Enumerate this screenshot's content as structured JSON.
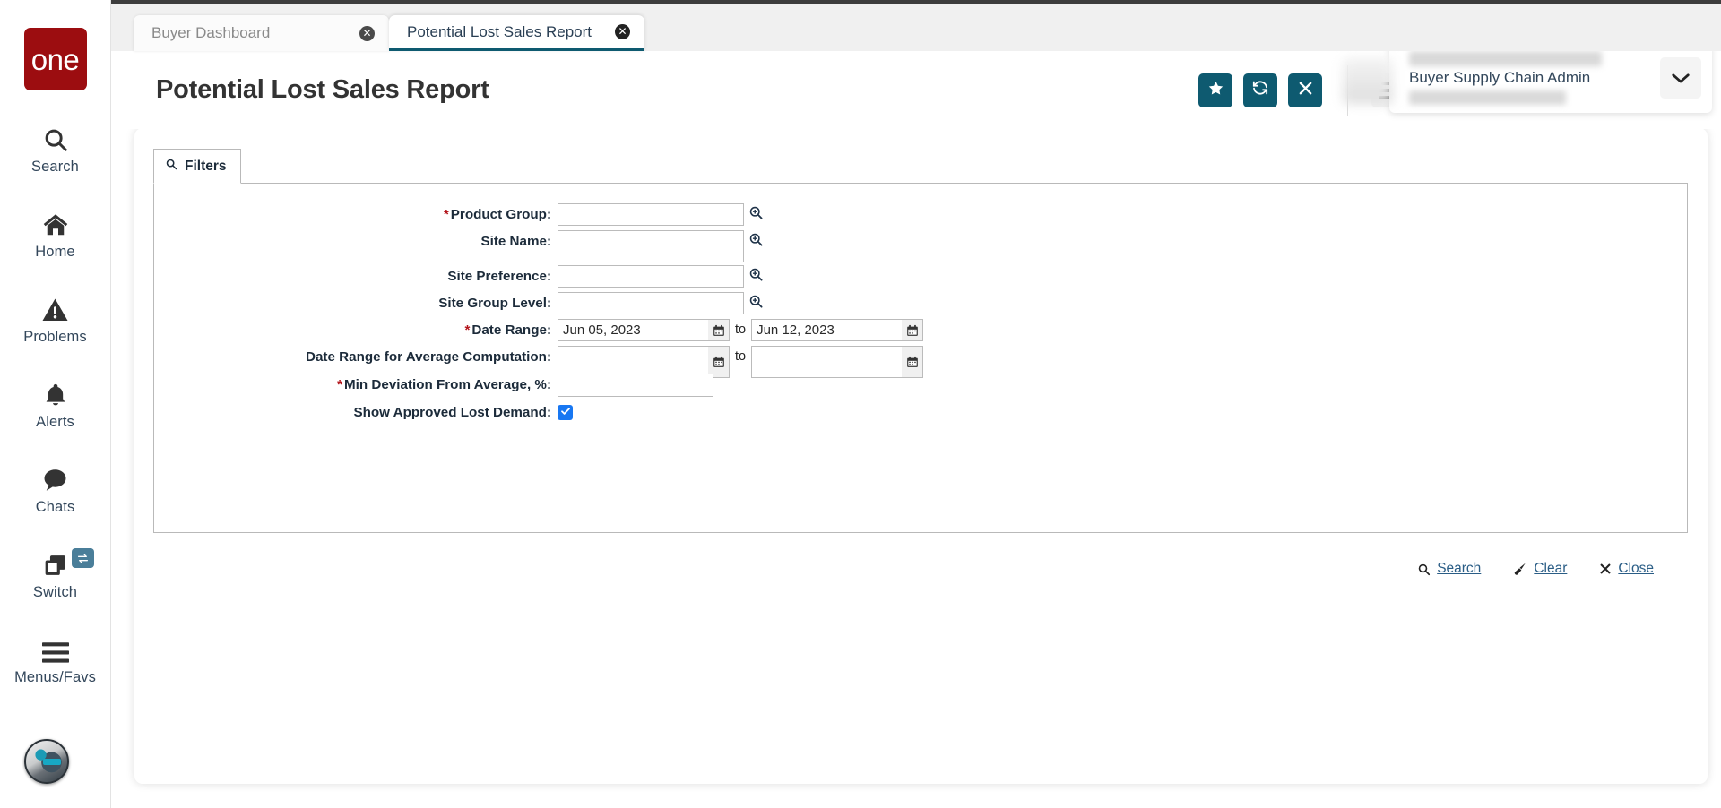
{
  "brand": {
    "logo_text": "one"
  },
  "sidebar": {
    "items": [
      {
        "label": "Search",
        "icon": "search-icon"
      },
      {
        "label": "Home",
        "icon": "home-icon"
      },
      {
        "label": "Problems",
        "icon": "warning-triangle-icon"
      },
      {
        "label": "Alerts",
        "icon": "bell-icon"
      },
      {
        "label": "Chats",
        "icon": "chat-bubble-icon"
      },
      {
        "label": "Switch",
        "icon": "switch-windows-icon",
        "badge_icon": "exchange-arrows-icon"
      },
      {
        "label": "Menus/Favs",
        "icon": "hamburger-icon"
      }
    ],
    "bot_avatar": "robot-assistant-avatar"
  },
  "tabs": [
    {
      "label": "Buyer Dashboard",
      "active": false,
      "close_icon": "close-circle-icon"
    },
    {
      "label": "Potential Lost Sales Report",
      "active": true,
      "close_icon": "close-circle-icon"
    }
  ],
  "header": {
    "title": "Potential Lost Sales Report",
    "buttons": [
      {
        "name": "favorite-button",
        "icon": "star-icon"
      },
      {
        "name": "refresh-button",
        "icon": "refresh-icon"
      },
      {
        "name": "close-button",
        "icon": "x-icon"
      }
    ],
    "menu_button": {
      "icon": "hamburger-icon",
      "badge_icon": "star-icon"
    },
    "user": {
      "name_redacted": "",
      "role": "Buyer Supply Chain Admin",
      "org_redacted": "",
      "caret_icon": "chevron-down-icon",
      "avatar": "user-avatar-blurred"
    },
    "accent_color": "#0e5a70",
    "badge_color": "#9c0d10"
  },
  "filters": {
    "panel_label": "Filters",
    "panel_icon": "search-icon",
    "fields": [
      {
        "name": "product-group",
        "label": "Product Group",
        "required": true,
        "type": "lookup",
        "value": "",
        "lookup_icon": "magnifier-plus-icon"
      },
      {
        "name": "site-name",
        "label": "Site Name",
        "required": false,
        "type": "lookup-tall",
        "value": "",
        "lookup_icon": "magnifier-plus-icon"
      },
      {
        "name": "site-preference",
        "label": "Site Preference",
        "required": false,
        "type": "lookup",
        "value": "",
        "lookup_icon": "magnifier-plus-icon"
      },
      {
        "name": "site-group-level",
        "label": "Site Group Level",
        "required": false,
        "type": "lookup",
        "value": "",
        "lookup_icon": "magnifier-plus-icon"
      }
    ],
    "date_range": {
      "label": "Date Range",
      "required": true,
      "from_value": "Jun 05, 2023",
      "to_value": "Jun 12, 2023",
      "separator": "to",
      "calendar_icon": "calendar-icon"
    },
    "avg_date_range": {
      "label": "Date Range for Average Computation",
      "required": false,
      "from_value": "",
      "to_value": "",
      "separator": "to",
      "calendar_icon": "calendar-icon"
    },
    "min_deviation": {
      "label": "Min Deviation From Average, %",
      "required": true,
      "value": ""
    },
    "show_approved": {
      "label": "Show Approved Lost Demand",
      "checked": true,
      "check_icon": "checkmark-icon",
      "check_color": "#1877f2"
    },
    "actions": [
      {
        "name": "search-action",
        "label": "Search",
        "icon": "search-icon"
      },
      {
        "name": "clear-action",
        "label": "Clear",
        "icon": "broom-icon"
      },
      {
        "name": "close-action",
        "label": "Close",
        "icon": "x-icon"
      }
    ]
  }
}
